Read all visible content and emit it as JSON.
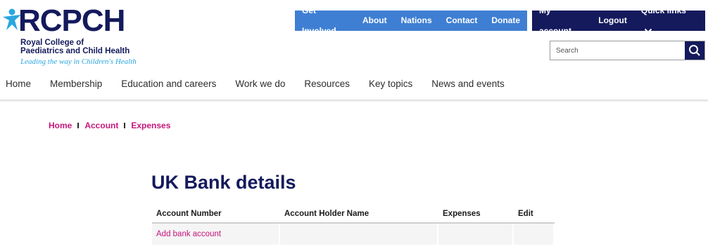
{
  "logo": {
    "name": "RCPCH",
    "line1": "Royal College of",
    "line2": "Paediatrics and Child Health",
    "tagline": "Leading the way in Children's Health"
  },
  "topnav": {
    "items": [
      "Get Involved",
      "About",
      "Nations",
      "Contact",
      "Donate"
    ]
  },
  "account_nav": {
    "my_account": "My account",
    "logout": "Logout",
    "quick_links": "Quick links"
  },
  "search": {
    "placeholder": "Search"
  },
  "mainnav": {
    "items": [
      "Home",
      "Membership",
      "Education and careers",
      "Work we do",
      "Resources",
      "Key topics",
      "News and events"
    ]
  },
  "breadcrumb": [
    "Home",
    "Account",
    "Expenses"
  ],
  "page": {
    "title": "UK Bank details"
  },
  "table": {
    "headers": [
      "Account Number",
      "Account Holder Name",
      "Expenses",
      "Edit"
    ],
    "add_link": "Add bank account"
  },
  "colors": {
    "navy": "#141a5c",
    "blue": "#3f7fd3",
    "magenta": "#c4167a",
    "sky": "#2aa7df"
  }
}
